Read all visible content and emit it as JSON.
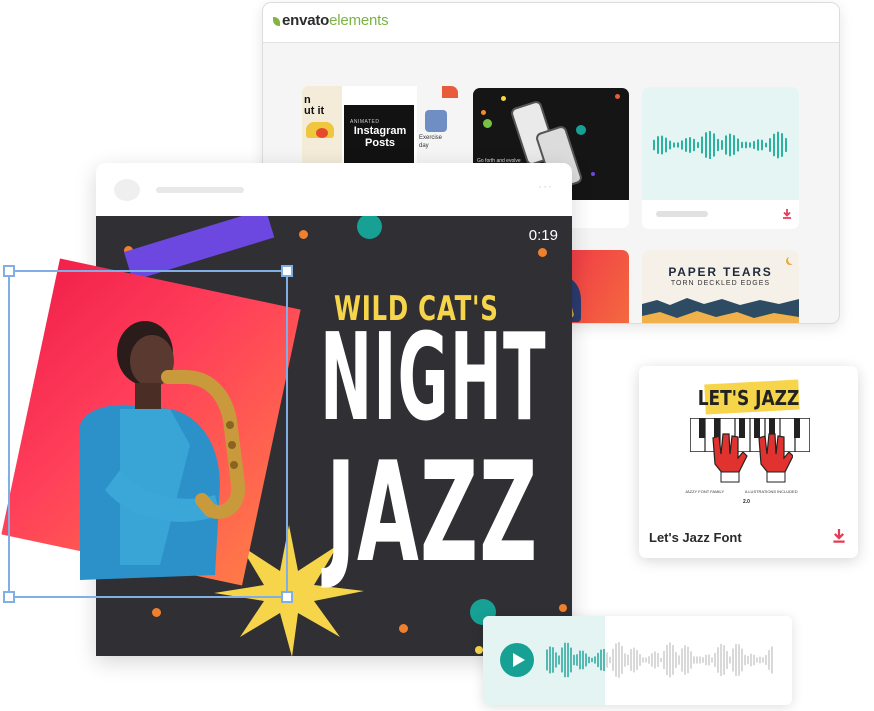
{
  "browser": {
    "logo_primary": "envato",
    "logo_secondary": "elements",
    "tile1_lines": [
      "n",
      "ut it"
    ],
    "tile1_title": "Instagram Posts",
    "tile1_kicker": "ANIMATED",
    "tile1_side": [
      "Exercise",
      "day"
    ],
    "tile2_caption": "Go forth and evolve",
    "paper_title": "PAPER TEARS",
    "paper_subtitle": "TORN DECKLED EDGES"
  },
  "poster": {
    "timer": "0:19",
    "line1": "WILD CAT'S",
    "line2": "NIGHT",
    "line3": "JAZZ"
  },
  "font_card": {
    "art_title": "LET'S JAZZ",
    "art_line_a": "JAZZY FONT FAMILY",
    "art_line_b": "ILLUSTRATIONS INCLUDED",
    "art_tag": "2.0",
    "label": "Let's Jazz Font"
  },
  "colors": {
    "accent_teal": "#17a094",
    "accent_red": "#e53c55",
    "poster_bg": "#2f2f34",
    "poster_yellow": "#f6d54a",
    "poster_purple": "#6d48e0",
    "selection_blue": "#82aee6"
  },
  "icons": [
    "envato-leaf-icon",
    "download-icon",
    "play-icon"
  ]
}
